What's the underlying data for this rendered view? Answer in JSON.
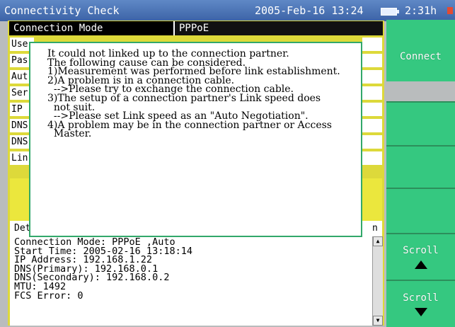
{
  "titlebar": {
    "title": "Connectivity Check",
    "datetime": "2005-Feb-16 13:24",
    "battery_time": "2:31h"
  },
  "connection_mode": {
    "label": "Connection Mode",
    "value": "PPPoE"
  },
  "row_labels": [
    "Use",
    "Pas",
    "Aut",
    "Ser",
    "IP",
    "DNS",
    "DNS",
    "Lin"
  ],
  "detail_header": {
    "left": "Det",
    "right": "n"
  },
  "popup": {
    "lines": [
      "It could not linked up to the connection partner.",
      "The following cause can be considered.",
      "1)Measurement was performed before link establishment.",
      "2)A problem is in a connection cable.",
      "  -->Please try to exchange the connection cable.",
      "3)The setup of a connection partner's Link speed does",
      "  not suit.",
      "  -->Please set Link speed as an \"Auto Negotiation\".",
      "4)A problem may be in the connection partner or Access",
      "  Master."
    ]
  },
  "detail_lines": [
    "Connection Mode: PPPoE ,Auto",
    "Start Time: 2005-02-16 13:18:14",
    "IP Address: 192.168.1.22",
    "DNS(Primary): 192.168.0.1",
    "DNS(Secondary): 192.168.0.2",
    "MTU: 1492",
    "FCS Error: 0"
  ],
  "softkeys": {
    "connect": "Connect",
    "scroll_up": "Scroll",
    "scroll_down": "Scroll"
  },
  "colors": {
    "titlebar": "#4a73b5",
    "softkey": "#35c880",
    "panel": "#ddd93a",
    "popup_border": "#32a86a",
    "record": "#e24b33"
  }
}
